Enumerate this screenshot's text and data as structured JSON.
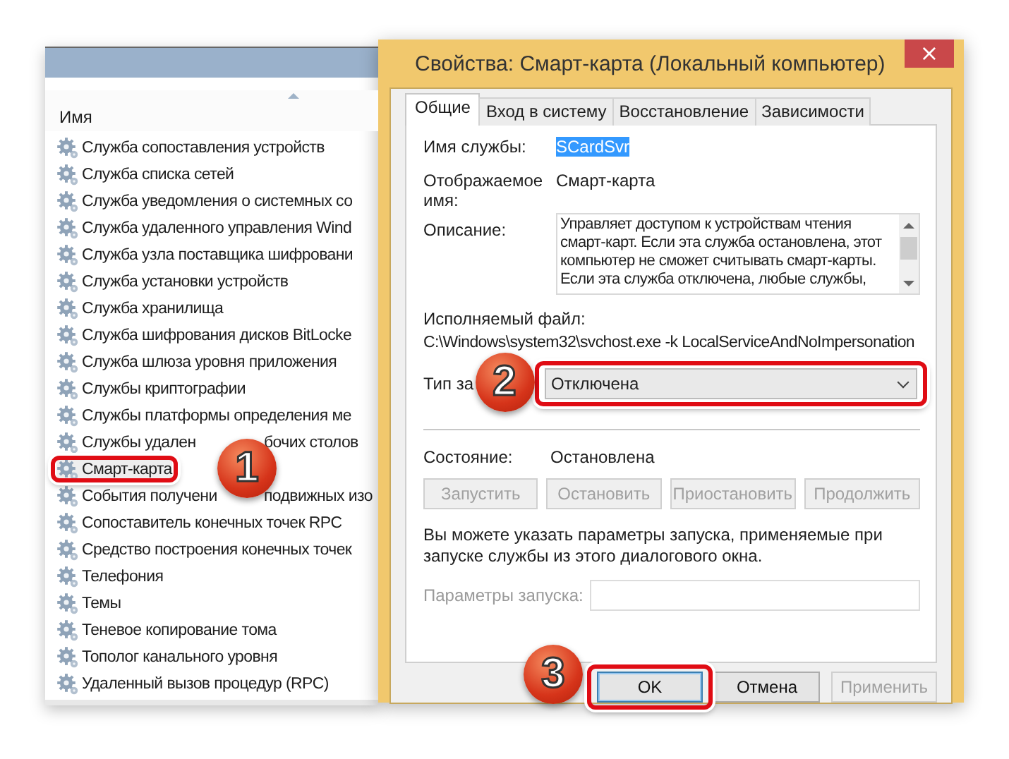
{
  "services_list": {
    "column_header": "Имя",
    "items": [
      {
        "name": "Служба сопоставления устройств",
        "selected": false
      },
      {
        "name": "Служба списка сетей",
        "selected": false
      },
      {
        "name": "Служба уведомления о системных со",
        "selected": false
      },
      {
        "name": "Служба удаленного управления Wind",
        "selected": false
      },
      {
        "name": "Служба узла поставщика шифровани",
        "selected": false
      },
      {
        "name": "Служба установки устройств",
        "selected": false
      },
      {
        "name": "Служба хранилища",
        "selected": false
      },
      {
        "name": "Служба шифрования дисков BitLocke",
        "selected": false
      },
      {
        "name": "Служба шлюза уровня приложения",
        "selected": false
      },
      {
        "name": "Службы криптографии",
        "selected": false
      },
      {
        "name": "Службы платформы определения ме",
        "selected": false
      },
      {
        "name": "Службы удален",
        "name_rest": "бочих столов",
        "selected": false
      },
      {
        "name": "Смарт-карта",
        "selected": true
      },
      {
        "name": "События получени",
        "name_rest": "подвижных изо",
        "selected": false
      },
      {
        "name": "Сопоставитель конечных точек RPC",
        "selected": false
      },
      {
        "name": "Средство построения конечных точек",
        "selected": false
      },
      {
        "name": "Телефония",
        "selected": false
      },
      {
        "name": "Темы",
        "selected": false
      },
      {
        "name": "Теневое копирование тома",
        "selected": false
      },
      {
        "name": "Тополог канального уровня",
        "selected": false
      },
      {
        "name": "Удаленный вызов процедур (RPC)",
        "selected": false
      }
    ]
  },
  "dialog": {
    "title": "Свойства: Смарт-карта (Локальный компьютер)",
    "close": "×",
    "tabs": [
      {
        "label": "Общие",
        "selected": true
      },
      {
        "label": "Вход в систему",
        "selected": false
      },
      {
        "label": "Восстановление",
        "selected": false
      },
      {
        "label": "Зависимости",
        "selected": false
      }
    ],
    "service_name": {
      "label": "Имя службы:",
      "value": "SCardSvr",
      "highlighted": true
    },
    "display_name": {
      "label": "Отображаемое имя:",
      "value": "Смарт-карта"
    },
    "description": {
      "label": "Описание:",
      "value": "Управляет доступом к устройствам чтения смарт-карт. Если эта служба остановлена, этот компьютер не сможет считывать смарт-карты. Если эта служба отключена, любые службы,"
    },
    "executable": {
      "label": "Исполняемый файл:",
      "value": "C:\\Windows\\system32\\svchost.exe -k LocalServiceAndNoImpersonation"
    },
    "startup_type": {
      "label": "Тип за",
      "value": "Отключена"
    },
    "status": {
      "label": "Состояние:",
      "value": "Остановлена"
    },
    "service_buttons": [
      {
        "label": "Запустить",
        "disabled": true
      },
      {
        "label": "Остановить",
        "disabled": true
      },
      {
        "label": "Приостановить",
        "disabled": true
      },
      {
        "label": "Продолжить",
        "disabled": true
      }
    ],
    "hint": "Вы можете указать параметры запуска, применяемые при запуске службы из этого диалогового окна.",
    "start_params": {
      "label": "Параметры запуска:",
      "disabled": true
    },
    "buttons": [
      {
        "label": "OK",
        "default": true,
        "disabled": false
      },
      {
        "label": "Отмена",
        "default": false,
        "disabled": false
      },
      {
        "label": "Применить",
        "default": false,
        "disabled": true
      }
    ]
  },
  "annotations": [
    {
      "label": "1"
    },
    {
      "label": "2"
    },
    {
      "label": "3"
    }
  ]
}
